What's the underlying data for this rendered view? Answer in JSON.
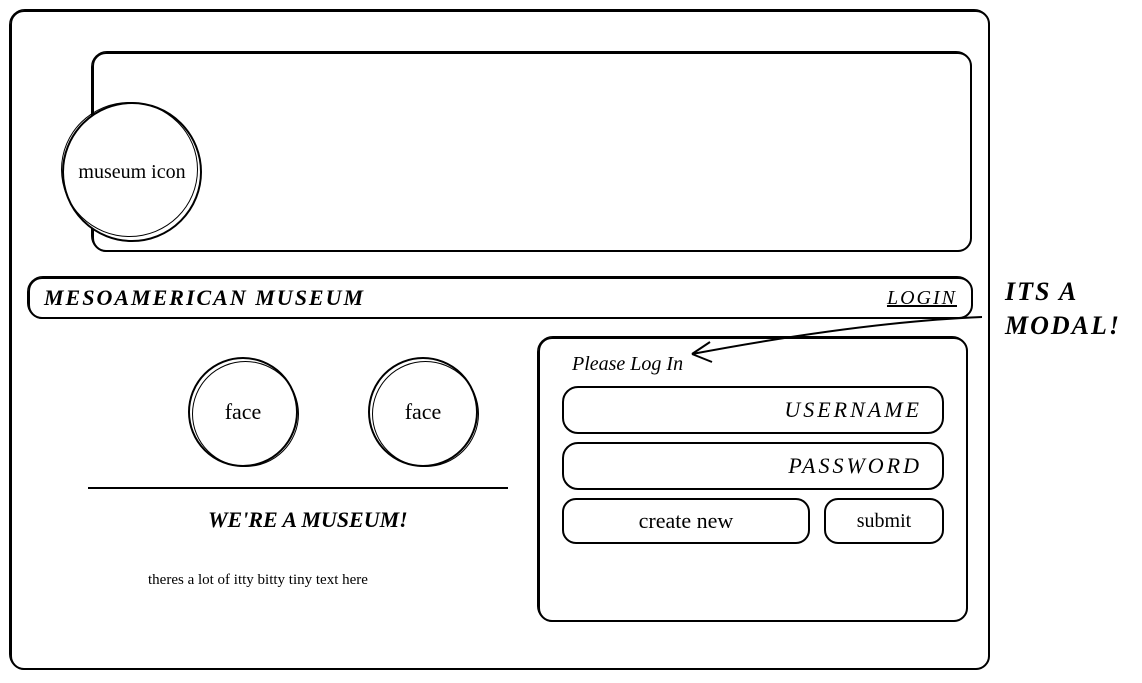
{
  "hero": {
    "icon_label": "museum icon"
  },
  "nav": {
    "brand": "MESOAMERICAN MUSEUM",
    "login_label": "LOGIN"
  },
  "content": {
    "face1_label": "face",
    "face2_label": "face",
    "welcome_heading": "WE'RE A MUSEUM!",
    "tiny_text": "theres a lot of itty bitty tiny text here"
  },
  "modal": {
    "title": "Please Log In",
    "username_placeholder": "USERNAME",
    "password_placeholder": "PASSWORD",
    "create_label": "create new",
    "submit_label": "submit"
  },
  "annotation": {
    "text": "ITS A MODAL!"
  }
}
